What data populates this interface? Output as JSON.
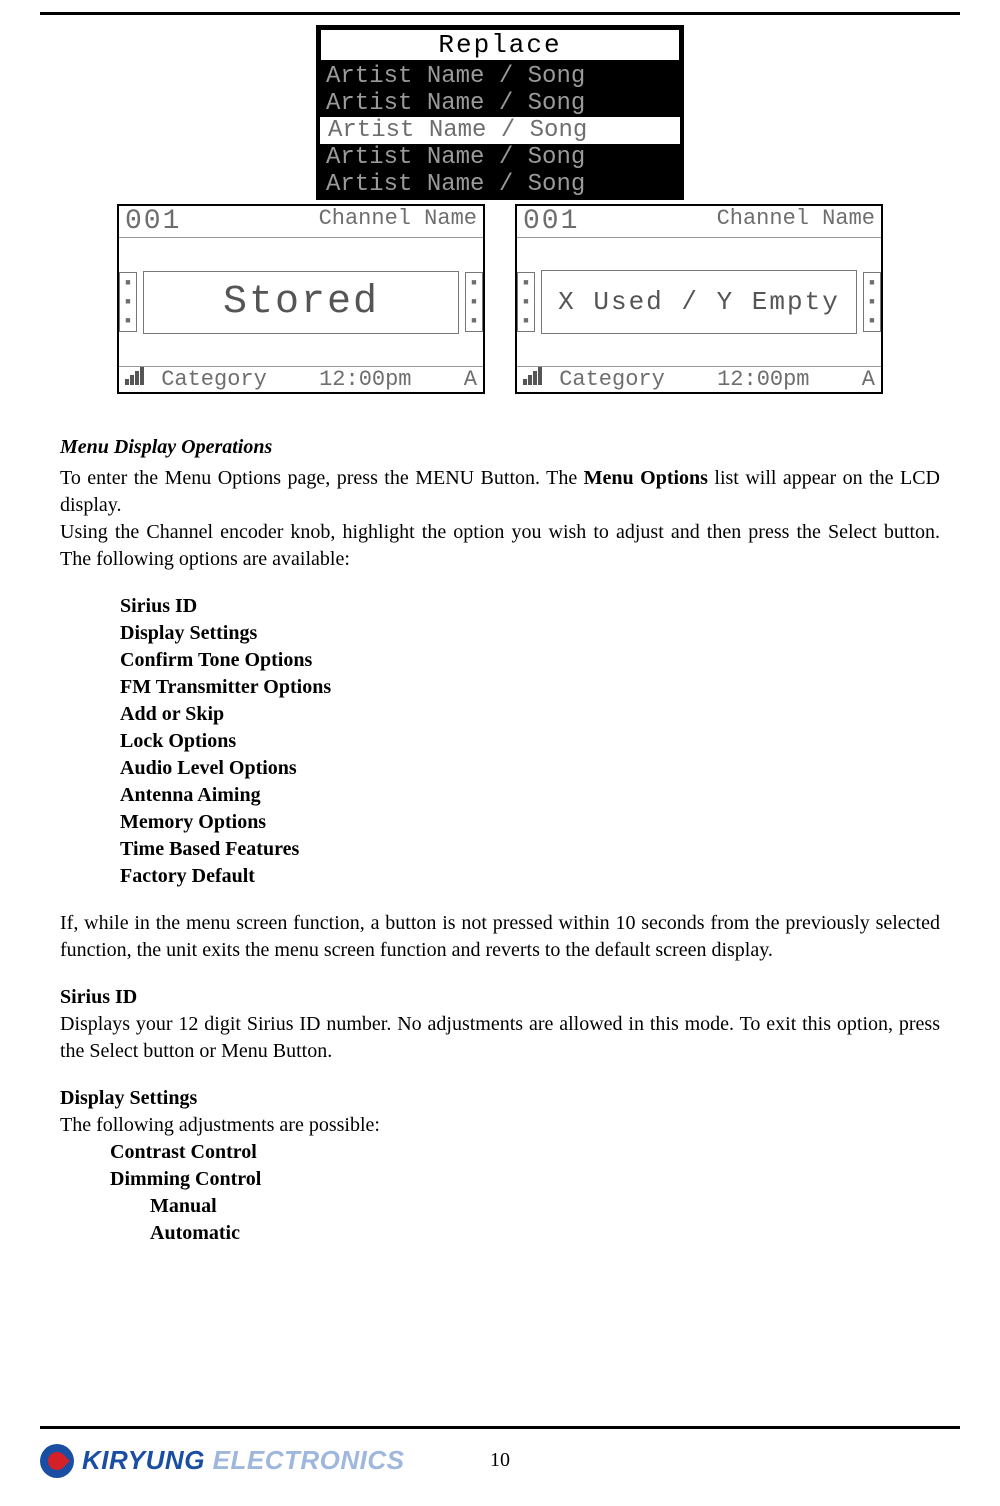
{
  "top_lcd": {
    "title": "Replace",
    "rows": [
      "Artist Name / Song",
      "Artist Name / Song",
      "Artist Name / Song",
      "Artist Name / Song",
      "Artist Name / Song"
    ],
    "selected_index": 2
  },
  "lcd_left": {
    "channel_num": "001",
    "channel_label": "Channel Name",
    "main": "Stored",
    "category": "Category",
    "time": "12:00pm",
    "ant": "A"
  },
  "lcd_right": {
    "channel_num": "001",
    "channel_label": "Channel Name",
    "main": "X Used / Y Empty",
    "category": "Category",
    "time": "12:00pm",
    "ant": "A"
  },
  "section_heading": "Menu Display Operations",
  "intro1a": "To enter the Menu Options page, press the MENU Button. The ",
  "intro1b": "Menu Options",
  "intro1c": " list will appear on the LCD display.",
  "intro2": "Using the Channel encoder knob, highlight the option you wish to adjust and then press the Select button. The following options are available:",
  "options": [
    "Sirius ID",
    "Display Settings",
    "Confirm Tone Options",
    "FM Transmitter Options",
    "Add or Skip",
    "Lock Options",
    "Audio Level Options",
    "Antenna Aiming",
    "Memory Options",
    "Time Based Features",
    "Factory Default"
  ],
  "timeout_para": "If, while  in the menu screen function, a button is not pressed  within  10 seconds  from the previously selected function, the unit exits the menu screen function and reverts to the default screen display.",
  "sirius_heading": "Sirius ID",
  "sirius_para": "Displays your 12 digit Sirius ID number. No adjustments are allowed in this  mode. To exit this option, press the Select button or Menu Button.",
  "display_heading": "Display Settings",
  "display_intro": "The following adjustments are possible:",
  "display_sub": {
    "contrast": "Contrast Control",
    "dimming": "Dimming Control",
    "manual": "Manual",
    "automatic": "Automatic"
  },
  "footer": {
    "brand_bold": "KIRYUNG",
    "brand_light": " ELECTRONICS",
    "page": "10"
  }
}
